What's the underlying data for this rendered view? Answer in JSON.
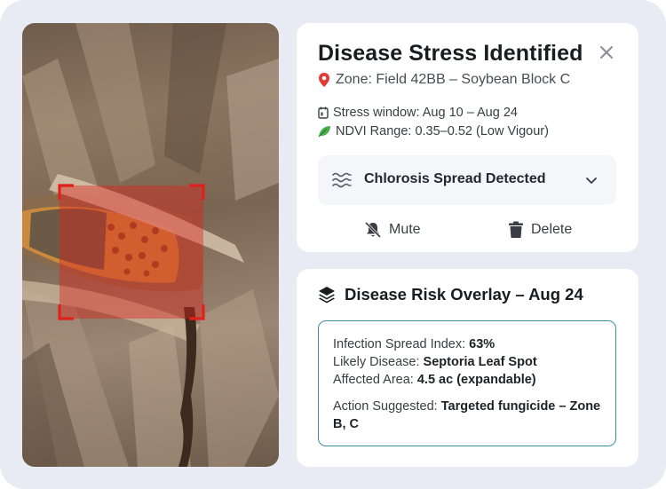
{
  "alert": {
    "title": "Disease Stress Identified",
    "zone": "Zone: Field 42BB – Soybean Block C",
    "stress_window": "Stress window: Aug 10 – Aug 24",
    "ndvi_range": "NDVI Range: 0.35–0.52 (Low Vigour)",
    "detection": "Chlorosis Spread Detected",
    "mute_label": "Mute",
    "delete_label": "Delete"
  },
  "overlay": {
    "title": "Disease Risk Overlay – Aug 24",
    "infection_label": "Infection Spread Index:",
    "infection_value": "63%",
    "disease_label": "Likely Disease:",
    "disease_value": "Septoria Leaf Spot",
    "area_label": "Affected Area:",
    "area_value": "4.5 ac (expandable)",
    "action_label": "Action Suggested:",
    "action_value": "Targeted fungicide – Zone B, C"
  },
  "colors": {
    "frame_bg": "#e8ebf3",
    "box_border": "#3b8fa0",
    "highlight": "#e0211b"
  },
  "icons": {
    "zone": "map-pin-icon",
    "stress": "calendar-icon",
    "ndvi": "leaf-icon",
    "detection": "waves-icon",
    "mute": "bell-off-icon",
    "delete": "trash-icon",
    "overlay": "layers-icon",
    "close": "close-icon"
  }
}
